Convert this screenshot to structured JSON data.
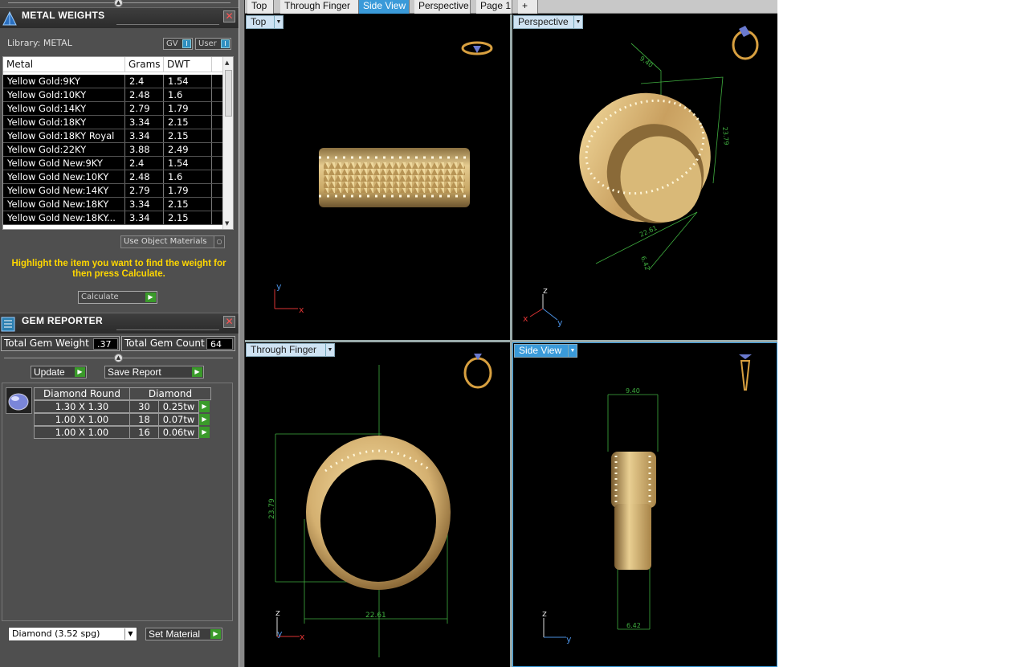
{
  "metal_panel": {
    "title": "METAL WEIGHTS",
    "library_label": "Library: METAL",
    "gv_label": "GV",
    "user_label": "User",
    "toggle_indicator": "I",
    "columns": [
      "Metal",
      "Grams",
      "DWT"
    ],
    "rows": [
      {
        "metal": "Yellow Gold:9KY",
        "grams": "2.4",
        "dwt": "1.54"
      },
      {
        "metal": "Yellow Gold:10KY",
        "grams": "2.48",
        "dwt": "1.6"
      },
      {
        "metal": "Yellow Gold:14KY",
        "grams": "2.79",
        "dwt": "1.79"
      },
      {
        "metal": "Yellow Gold:18KY",
        "grams": "3.34",
        "dwt": "2.15"
      },
      {
        "metal": "Yellow Gold:18KY Royal",
        "grams": "3.34",
        "dwt": "2.15"
      },
      {
        "metal": "Yellow Gold:22KY",
        "grams": "3.88",
        "dwt": "2.49"
      },
      {
        "metal": "Yellow Gold New:9KY",
        "grams": "2.4",
        "dwt": "1.54"
      },
      {
        "metal": "Yellow Gold New:10KY",
        "grams": "2.48",
        "dwt": "1.6"
      },
      {
        "metal": "Yellow Gold New:14KY",
        "grams": "2.79",
        "dwt": "1.79"
      },
      {
        "metal": "Yellow Gold New:18KY",
        "grams": "3.34",
        "dwt": "2.15"
      },
      {
        "metal": "Yellow Gold New:18KY...",
        "grams": "3.34",
        "dwt": "2.15"
      }
    ],
    "use_object_materials": "Use Object Materials",
    "hint": "Highlight the item you want to find the weight for then press Calculate.",
    "calculate_label": "Calculate",
    "scroll_up_glyph": "▲",
    "scroll_down_glyph": "▼",
    "arrow_glyph": "▶",
    "close_glyph": "✕"
  },
  "gem_panel": {
    "title": "GEM REPORTER",
    "total_weight_label": "Total Gem Weight",
    "total_weight_value": ".37",
    "total_count_label": "Total Gem Count",
    "total_count_value": "64",
    "update_label": "Update",
    "save_report_label": "Save Report",
    "col_shape": "Diamond Round",
    "col_material": "Diamond",
    "rows": [
      {
        "size": "1.30 X 1.30",
        "count": "30",
        "weight": "0.25tw"
      },
      {
        "size": "1.00 X 1.00",
        "count": "18",
        "weight": "0.07tw"
      },
      {
        "size": "1.00 X 1.00",
        "count": "16",
        "weight": "0.06tw"
      }
    ],
    "material_select": "Diamond     (3.52 spg)",
    "set_material_label": "Set Material",
    "dropdown_glyph": "▼"
  },
  "tabs": [
    "Top",
    "Through Finger",
    "Side View",
    "Perspective",
    "Page 1",
    "+"
  ],
  "active_tab": "Side View",
  "viewports": {
    "top": {
      "label": "Top"
    },
    "perspective": {
      "label": "Perspective",
      "dims": [
        "9.40",
        "23.79",
        "22.61",
        "6.42"
      ]
    },
    "through_finger": {
      "label": "Through Finger",
      "dim_height": "23.79",
      "dim_width": "22.61"
    },
    "side_view": {
      "label": "Side View",
      "dim_top": "9.40",
      "dim_bottom": "6.42"
    }
  },
  "axes": {
    "x": "x",
    "y": "y",
    "z": "z"
  },
  "colors": {
    "gold": "#d8b877",
    "dimension_green": "#3fae3f",
    "accent_blue": "#3a9ad9",
    "hint_yellow": "#ffd700"
  }
}
